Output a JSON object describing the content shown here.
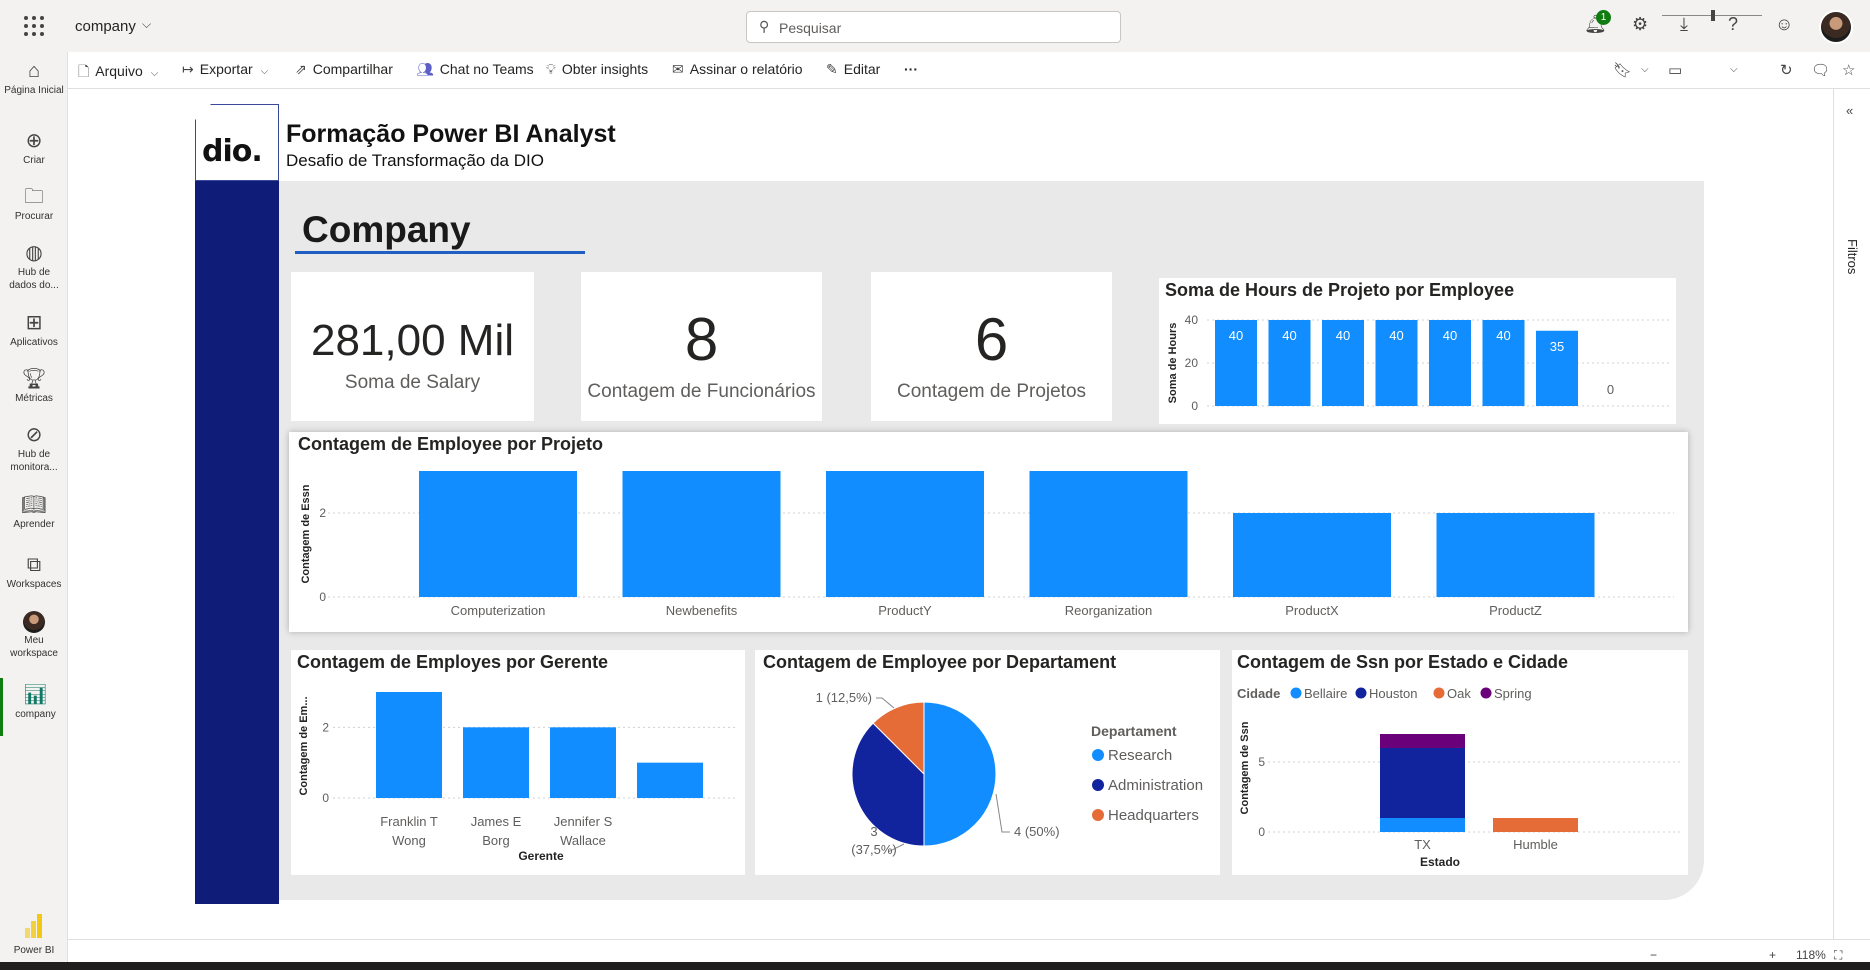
{
  "topbar": {
    "workspace": "company",
    "search_placeholder": "Pesquisar",
    "notification_count": "1"
  },
  "leftnav": [
    {
      "label": "Página Inicial",
      "icon": "home-icon"
    },
    {
      "label": "Criar",
      "icon": "create-icon"
    },
    {
      "label": "Procurar",
      "icon": "folder-icon"
    },
    {
      "label": "Hub de dados do...",
      "icon": "data-hub-icon"
    },
    {
      "label": "Aplicativos",
      "icon": "apps-icon"
    },
    {
      "label": "Métricas",
      "icon": "trophy-icon"
    },
    {
      "label": "Hub de monitora...",
      "icon": "monitor-icon"
    },
    {
      "label": "Aprender",
      "icon": "book-icon"
    },
    {
      "label": "Workspaces",
      "icon": "workspaces-icon"
    },
    {
      "label": "Meu workspace",
      "icon": "avatar"
    },
    {
      "label": "company",
      "icon": "report-icon"
    }
  ],
  "brand": "Power BI",
  "actionbar": {
    "arquivo": "Arquivo",
    "exportar": "Exportar",
    "compartilhar": "Compartilhar",
    "chat_teams": "Chat no Teams",
    "insights": "Obter insights",
    "assinar": "Assinar o relatório",
    "editar": "Editar",
    "more": "···"
  },
  "filters_label": "Filtros",
  "zoom": "118%",
  "report": {
    "logo": "dio.",
    "title": "Formação Power BI Analyst",
    "subtitle": "Desafio de Transformação da DIO",
    "page_heading": "Company"
  },
  "kpis": [
    {
      "value": "281,00 Mil",
      "label": "Soma de Salary"
    },
    {
      "value": "8",
      "label": "Contagem de Funcionários"
    },
    {
      "value": "6",
      "label": "Contagem de Projetos"
    }
  ],
  "colors": {
    "bar_blue": "#118dff",
    "navy": "#12239e",
    "orange": "#e66c37",
    "purple": "#6b007b",
    "sidebar": "#101d78"
  },
  "chart_data": [
    {
      "type": "bar",
      "title": "Soma de Hours de Projeto por Employee",
      "ylabel": "Soma de Hours",
      "yticks": [
        "0",
        "20",
        "40"
      ],
      "ylim": [
        0,
        40
      ],
      "values": [
        40,
        40,
        40,
        40,
        40,
        40,
        35,
        0
      ],
      "data_labels": [
        "40",
        "40",
        "40",
        "40",
        "40",
        "40",
        "35",
        "0"
      ]
    },
    {
      "type": "bar",
      "title": "Contagem de Employee por Projeto",
      "ylabel": "Contagem de Essn",
      "yticks": [
        "0",
        "2"
      ],
      "ylim": [
        0,
        3
      ],
      "categories": [
        "Computerization",
        "Newbenefits",
        "ProductY",
        "Reorganization",
        "ProductX",
        "ProductZ"
      ],
      "values": [
        3,
        3,
        3,
        3,
        2,
        2
      ]
    },
    {
      "type": "bar",
      "title": "Contagem de Employes por Gerente",
      "ylabel": "Contagem de Em...",
      "xlabel": "Gerente",
      "yticks": [
        "0",
        "2"
      ],
      "ylim": [
        0,
        3
      ],
      "categories": [
        "Franklin T Wong",
        "James E Borg",
        "Jennifer S Wallace",
        ""
      ],
      "category_lines": [
        [
          "Franklin T",
          "Wong"
        ],
        [
          "James E",
          "Borg"
        ],
        [
          "Jennifer S",
          "Wallace"
        ],
        [
          "",
          ""
        ]
      ],
      "values": [
        3,
        2,
        2,
        1
      ]
    },
    {
      "type": "pie",
      "title": "Contagem de Employee por Departament",
      "legend_title": "Departament",
      "slices": [
        {
          "name": "Research",
          "value": 4,
          "label": "4 (50%)"
        },
        {
          "name": "Administration",
          "value": 3,
          "label": "3 (37,5%)",
          "label_lines": [
            "3",
            "(37,5%)"
          ]
        },
        {
          "name": "Headquarters",
          "value": 1,
          "label": "1 (12,5%)"
        }
      ]
    },
    {
      "type": "bar",
      "stacked": true,
      "title": "Contagem de Ssn por Estado e Cidade",
      "legend_title": "Cidade",
      "ylabel": "Contagem de Ssn",
      "xlabel": "Estado",
      "yticks": [
        "0",
        "5"
      ],
      "ylim": [
        0,
        8
      ],
      "categories": [
        "TX",
        "Humble"
      ],
      "series": [
        {
          "name": "Bellaire",
          "values": [
            1,
            0
          ]
        },
        {
          "name": "Houston",
          "values": [
            5,
            0
          ]
        },
        {
          "name": "Oak",
          "values": [
            0,
            1
          ]
        },
        {
          "name": "Spring",
          "values": [
            1,
            0
          ]
        }
      ]
    }
  ]
}
